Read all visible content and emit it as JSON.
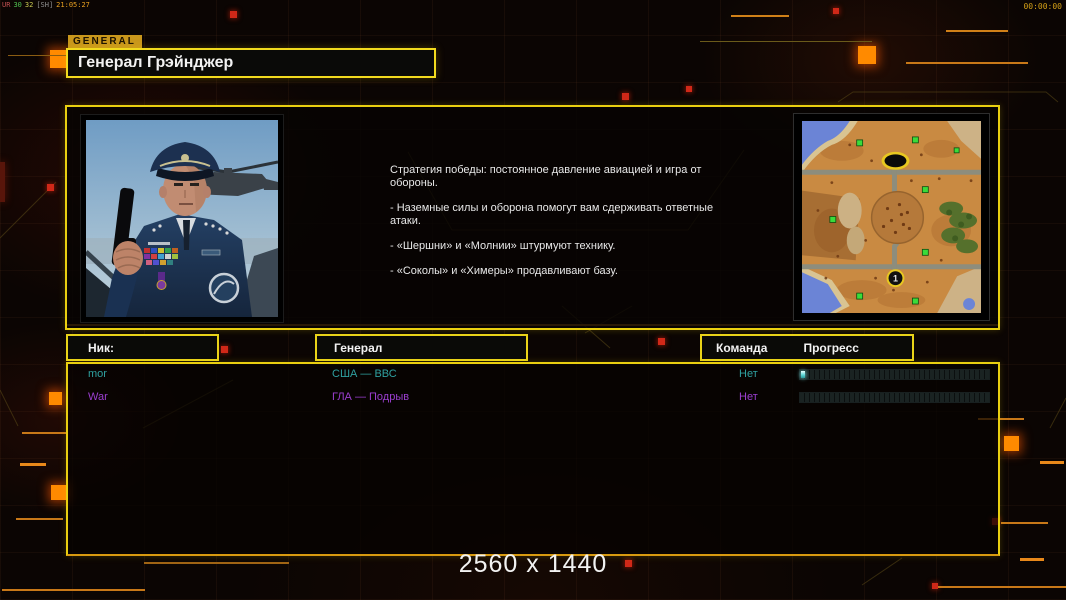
{
  "osd": {
    "segments": [
      {
        "text": "UR",
        "color": "#c05050"
      },
      {
        "text": "30",
        "color": "#50c050"
      },
      {
        "text": "32",
        "color": "#c8c850"
      },
      {
        "text": "[SH]",
        "color": "#909090"
      },
      {
        "text": "21:05:27",
        "color": "#e8a020"
      }
    ]
  },
  "timer": "00:00:00",
  "header": {
    "tag": "GENERAL",
    "title": "Генерал Грэйнджер"
  },
  "briefing": {
    "paragraphs": [
      "Стратегия победы: постоянное давление авиацией и игра от обороны.",
      "- Наземные силы и оборона помогут вам сдерживать ответные атаки.",
      "- «Шершни» и «Молнии» штурмуют технику.",
      "- «Соколы» и «Химеры» продавливают базу."
    ]
  },
  "minimap": {
    "marker_label": "1"
  },
  "table": {
    "nick_header": "Ник:",
    "general_header": "Генерал",
    "team_header": "Команда",
    "progress_header": "Прогресс",
    "rows": [
      {
        "nick": "mor",
        "general": "США — ВВС",
        "team": "Нет",
        "progress_percent": 2,
        "color": "#2fa0a0"
      },
      {
        "nick": "War",
        "general": "ГЛА — Подрыв",
        "team": "Нет",
        "progress_percent": 0,
        "color": "#9b3fd0"
      }
    ]
  },
  "footer": {
    "resolution": "2560 x 1440"
  },
  "colors": {
    "accent_yellow": "#e9cf10",
    "accent_orange": "#ff8a00",
    "accent_red": "#d02818"
  }
}
